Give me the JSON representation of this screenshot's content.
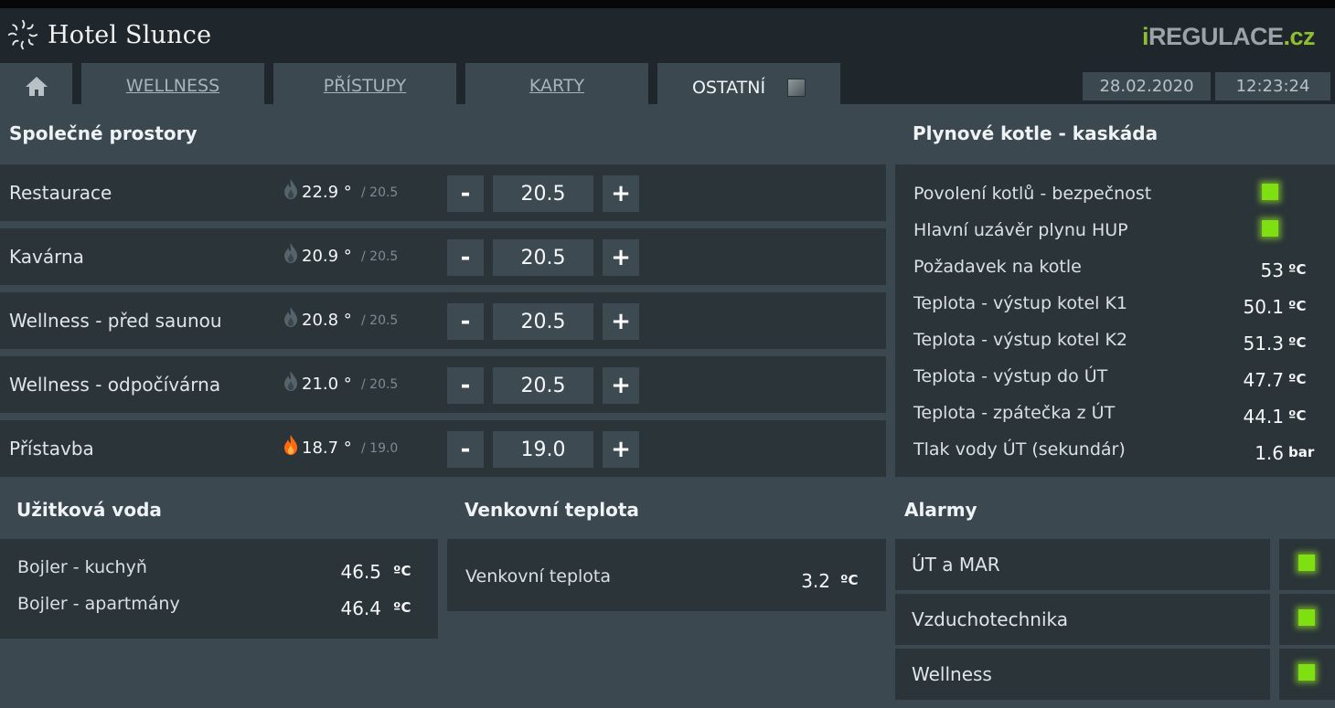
{
  "header": {
    "app_title": "Hotel Slunce",
    "brand_i": "i",
    "brand_mid": "REGULACE",
    "brand_tld": ".cz",
    "date": "28.02.2020",
    "time": "12:23:24"
  },
  "tabs": [
    {
      "label": "WELLNESS"
    },
    {
      "label": "PŘÍSTUPY"
    },
    {
      "label": "KARTY"
    },
    {
      "label": "OSTATNÍ",
      "active": true
    }
  ],
  "spolecne": {
    "title": "Společné prostory",
    "rooms": [
      {
        "name": "Restaurace",
        "current": "22.9 °",
        "setpoint_small": "/ 20.5",
        "setpoint": "20.5",
        "heating": false
      },
      {
        "name": "Kavárna",
        "current": "20.9 °",
        "setpoint_small": "/ 20.5",
        "setpoint": "20.5",
        "heating": false
      },
      {
        "name": "Wellness - před saunou",
        "current": "20.8 °",
        "setpoint_small": "/ 20.5",
        "setpoint": "20.5",
        "heating": false
      },
      {
        "name": "Wellness - odpočívárna",
        "current": "21.0 °",
        "setpoint_small": "/ 20.5",
        "setpoint": "20.5",
        "heating": false
      },
      {
        "name": "Přístavba",
        "current": "18.7 °",
        "setpoint_small": "/ 19.0",
        "setpoint": "19.0",
        "heating": true
      }
    ],
    "minus_label": "-",
    "plus_label": "+"
  },
  "kotle": {
    "title": "Plynové kotle - kaskáda",
    "status_items": [
      {
        "label": "Povolení kotlů - bezpečnost"
      },
      {
        "label": "Hlavní uzávěr plynu HUP"
      }
    ],
    "values": [
      {
        "label": "Požadavek na kotle",
        "value": "53",
        "unit": "ºC"
      },
      {
        "label": "Teplota - výstup kotel K1",
        "value": "50.1",
        "unit": "ºC"
      },
      {
        "label": "Teplota - výstup kotel K2",
        "value": "51.3",
        "unit": "ºC"
      },
      {
        "label": "Teplota - výstup do ÚT",
        "value": "47.7",
        "unit": "ºC"
      },
      {
        "label": "Teplota - zpátečka z ÚT",
        "value": "44.1",
        "unit": "ºC"
      },
      {
        "label": "Tlak vody ÚT (sekundár)",
        "value": "1.6",
        "unit": "bar"
      }
    ]
  },
  "uzitkova": {
    "title": "Užitková voda",
    "items": [
      {
        "label": "Bojler - kuchyň",
        "value": "46.5",
        "unit": "ºC"
      },
      {
        "label": "Bojler - apartmány",
        "value": "46.4",
        "unit": "ºC"
      }
    ]
  },
  "venkovni": {
    "title": "Venkovní teplota",
    "label": "Venkovní teplota",
    "value": "3.2",
    "unit": "ºC"
  },
  "alarmy": {
    "title": "Alarmy",
    "items": [
      {
        "label": "ÚT a MAR"
      },
      {
        "label": "Vzduchotechnika"
      },
      {
        "label": "Wellness"
      }
    ]
  },
  "colors": {
    "led_on": "#7ee010",
    "flame_idle": "#55636a",
    "flame_active": "#ff6a10"
  }
}
